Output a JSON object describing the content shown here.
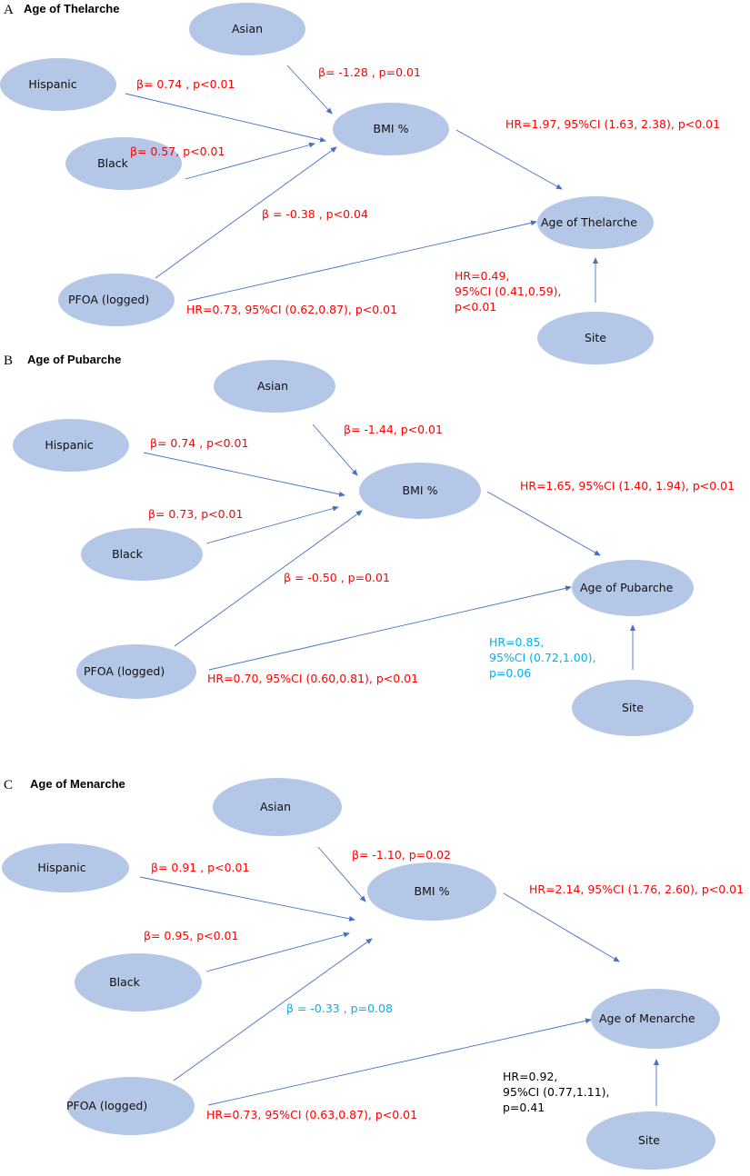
{
  "figure": {
    "colors": {
      "node_fill": "#b4c7e7",
      "edge": "#4472c4",
      "significant": "#ff0000",
      "marginal": "#00b0f0",
      "nonsignificant": "#000000"
    },
    "panels": [
      {
        "letter": "A",
        "title": "Age of  Thelarche",
        "nodes": {
          "asian": "Asian",
          "hispanic": "Hispanic",
          "black": "Black",
          "pfoa": "PFOA (logged)",
          "bmi": "BMI %",
          "outcome": "Age of Thelarche",
          "site": "Site"
        },
        "edges": [
          {
            "from": "asian",
            "to": "bmi",
            "label": [
              "β= -1.28 , p=0.01"
            ],
            "status": "significant"
          },
          {
            "from": "hispanic",
            "to": "bmi",
            "label": [
              "β= 0.74 , p<0.01"
            ],
            "status": "significant"
          },
          {
            "from": "black",
            "to": "bmi",
            "label": [
              "β= 0.57, p<0.01"
            ],
            "status": "significant"
          },
          {
            "from": "pfoa",
            "to": "bmi",
            "label": [
              "β = -0.38 , p<0.04"
            ],
            "status": "significant"
          },
          {
            "from": "bmi",
            "to": "outcome",
            "label": [
              "HR=1.97, 95%CI  (1.63, 2.38), p<0.01"
            ],
            "status": "significant"
          },
          {
            "from": "pfoa",
            "to": "outcome",
            "label": [
              "HR=0.73, 95%CI  (0.62,0.87), p<0.01"
            ],
            "status": "significant"
          },
          {
            "from": "site",
            "to": "outcome",
            "label": [
              "HR=0.49,",
              "95%CI  (0.41,0.59),",
              "p<0.01"
            ],
            "status": "significant"
          }
        ]
      },
      {
        "letter": "B",
        "title": "Age of Pubarche",
        "nodes": {
          "asian": "Asian",
          "hispanic": "Hispanic",
          "black": "Black",
          "pfoa": "PFOA (logged)",
          "bmi": "BMI %",
          "outcome": "Age of Pubarche",
          "site": "Site"
        },
        "edges": [
          {
            "from": "asian",
            "to": "bmi",
            "label": [
              "β= -1.44, p<0.01"
            ],
            "status": "significant"
          },
          {
            "from": "hispanic",
            "to": "bmi",
            "label": [
              "β= 0.74 , p<0.01"
            ],
            "status": "significant"
          },
          {
            "from": "black",
            "to": "bmi",
            "label": [
              "β= 0.73, p<0.01"
            ],
            "status": "significant"
          },
          {
            "from": "pfoa",
            "to": "bmi",
            "label": [
              "β = -0.50 , p=0.01"
            ],
            "status": "significant"
          },
          {
            "from": "bmi",
            "to": "outcome",
            "label": [
              "HR=1.65, 95%CI  (1.40, 1.94), p<0.01"
            ],
            "status": "significant"
          },
          {
            "from": "pfoa",
            "to": "outcome",
            "label": [
              "HR=0.70, 95%CI  (0.60,0.81), p<0.01"
            ],
            "status": "significant"
          },
          {
            "from": "site",
            "to": "outcome",
            "label": [
              "HR=0.85,",
              "95%CI  (0.72,1.00),",
              "p=0.06"
            ],
            "status": "marginal"
          }
        ]
      },
      {
        "letter": "C",
        "title": "Age of Menarche",
        "nodes": {
          "asian": "Asian",
          "hispanic": "Hispanic",
          "black": "Black",
          "pfoa": "PFOA (logged)",
          "bmi": "BMI %",
          "outcome": "Age of Menarche",
          "site": "Site"
        },
        "edges": [
          {
            "from": "asian",
            "to": "bmi",
            "label": [
              "β= -1.10, p=0.02"
            ],
            "status": "significant"
          },
          {
            "from": "hispanic",
            "to": "bmi",
            "label": [
              "β= 0.91 , p<0.01"
            ],
            "status": "significant"
          },
          {
            "from": "black",
            "to": "bmi",
            "label": [
              "β= 0.95, p<0.01"
            ],
            "status": "significant"
          },
          {
            "from": "pfoa",
            "to": "bmi",
            "label": [
              "β = -0.33 , p=0.08"
            ],
            "status": "marginal"
          },
          {
            "from": "bmi",
            "to": "outcome",
            "label": [
              "HR=2.14, 95%CI  (1.76, 2.60), p<0.01"
            ],
            "status": "significant"
          },
          {
            "from": "pfoa",
            "to": "outcome",
            "label": [
              "HR=0.73, 95%CI  (0.63,0.87), p<0.01"
            ],
            "status": "significant"
          },
          {
            "from": "site",
            "to": "outcome",
            "label": [
              "HR=0.92,",
              "95%CI  (0.77,1.11),",
              "p=0.41"
            ],
            "status": "nonsignificant"
          }
        ]
      }
    ]
  }
}
